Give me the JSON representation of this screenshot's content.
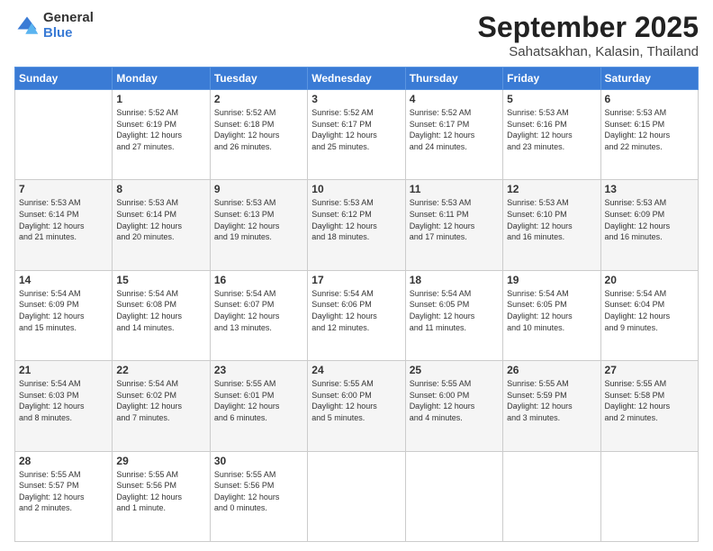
{
  "logo": {
    "general": "General",
    "blue": "Blue"
  },
  "title": "September 2025",
  "subtitle": "Sahatsakhan, Kalasin, Thailand",
  "days": [
    "Sunday",
    "Monday",
    "Tuesday",
    "Wednesday",
    "Thursday",
    "Friday",
    "Saturday"
  ],
  "weeks": [
    [
      {
        "day": "",
        "info": ""
      },
      {
        "day": "1",
        "info": "Sunrise: 5:52 AM\nSunset: 6:19 PM\nDaylight: 12 hours\nand 27 minutes."
      },
      {
        "day": "2",
        "info": "Sunrise: 5:52 AM\nSunset: 6:18 PM\nDaylight: 12 hours\nand 26 minutes."
      },
      {
        "day": "3",
        "info": "Sunrise: 5:52 AM\nSunset: 6:17 PM\nDaylight: 12 hours\nand 25 minutes."
      },
      {
        "day": "4",
        "info": "Sunrise: 5:52 AM\nSunset: 6:17 PM\nDaylight: 12 hours\nand 24 minutes."
      },
      {
        "day": "5",
        "info": "Sunrise: 5:53 AM\nSunset: 6:16 PM\nDaylight: 12 hours\nand 23 minutes."
      },
      {
        "day": "6",
        "info": "Sunrise: 5:53 AM\nSunset: 6:15 PM\nDaylight: 12 hours\nand 22 minutes."
      }
    ],
    [
      {
        "day": "7",
        "info": "Sunrise: 5:53 AM\nSunset: 6:14 PM\nDaylight: 12 hours\nand 21 minutes."
      },
      {
        "day": "8",
        "info": "Sunrise: 5:53 AM\nSunset: 6:14 PM\nDaylight: 12 hours\nand 20 minutes."
      },
      {
        "day": "9",
        "info": "Sunrise: 5:53 AM\nSunset: 6:13 PM\nDaylight: 12 hours\nand 19 minutes."
      },
      {
        "day": "10",
        "info": "Sunrise: 5:53 AM\nSunset: 6:12 PM\nDaylight: 12 hours\nand 18 minutes."
      },
      {
        "day": "11",
        "info": "Sunrise: 5:53 AM\nSunset: 6:11 PM\nDaylight: 12 hours\nand 17 minutes."
      },
      {
        "day": "12",
        "info": "Sunrise: 5:53 AM\nSunset: 6:10 PM\nDaylight: 12 hours\nand 16 minutes."
      },
      {
        "day": "13",
        "info": "Sunrise: 5:53 AM\nSunset: 6:09 PM\nDaylight: 12 hours\nand 16 minutes."
      }
    ],
    [
      {
        "day": "14",
        "info": "Sunrise: 5:54 AM\nSunset: 6:09 PM\nDaylight: 12 hours\nand 15 minutes."
      },
      {
        "day": "15",
        "info": "Sunrise: 5:54 AM\nSunset: 6:08 PM\nDaylight: 12 hours\nand 14 minutes."
      },
      {
        "day": "16",
        "info": "Sunrise: 5:54 AM\nSunset: 6:07 PM\nDaylight: 12 hours\nand 13 minutes."
      },
      {
        "day": "17",
        "info": "Sunrise: 5:54 AM\nSunset: 6:06 PM\nDaylight: 12 hours\nand 12 minutes."
      },
      {
        "day": "18",
        "info": "Sunrise: 5:54 AM\nSunset: 6:05 PM\nDaylight: 12 hours\nand 11 minutes."
      },
      {
        "day": "19",
        "info": "Sunrise: 5:54 AM\nSunset: 6:05 PM\nDaylight: 12 hours\nand 10 minutes."
      },
      {
        "day": "20",
        "info": "Sunrise: 5:54 AM\nSunset: 6:04 PM\nDaylight: 12 hours\nand 9 minutes."
      }
    ],
    [
      {
        "day": "21",
        "info": "Sunrise: 5:54 AM\nSunset: 6:03 PM\nDaylight: 12 hours\nand 8 minutes."
      },
      {
        "day": "22",
        "info": "Sunrise: 5:54 AM\nSunset: 6:02 PM\nDaylight: 12 hours\nand 7 minutes."
      },
      {
        "day": "23",
        "info": "Sunrise: 5:55 AM\nSunset: 6:01 PM\nDaylight: 12 hours\nand 6 minutes."
      },
      {
        "day": "24",
        "info": "Sunrise: 5:55 AM\nSunset: 6:00 PM\nDaylight: 12 hours\nand 5 minutes."
      },
      {
        "day": "25",
        "info": "Sunrise: 5:55 AM\nSunset: 6:00 PM\nDaylight: 12 hours\nand 4 minutes."
      },
      {
        "day": "26",
        "info": "Sunrise: 5:55 AM\nSunset: 5:59 PM\nDaylight: 12 hours\nand 3 minutes."
      },
      {
        "day": "27",
        "info": "Sunrise: 5:55 AM\nSunset: 5:58 PM\nDaylight: 12 hours\nand 2 minutes."
      }
    ],
    [
      {
        "day": "28",
        "info": "Sunrise: 5:55 AM\nSunset: 5:57 PM\nDaylight: 12 hours\nand 2 minutes."
      },
      {
        "day": "29",
        "info": "Sunrise: 5:55 AM\nSunset: 5:56 PM\nDaylight: 12 hours\nand 1 minute."
      },
      {
        "day": "30",
        "info": "Sunrise: 5:55 AM\nSunset: 5:56 PM\nDaylight: 12 hours\nand 0 minutes."
      },
      {
        "day": "",
        "info": ""
      },
      {
        "day": "",
        "info": ""
      },
      {
        "day": "",
        "info": ""
      },
      {
        "day": "",
        "info": ""
      }
    ]
  ]
}
